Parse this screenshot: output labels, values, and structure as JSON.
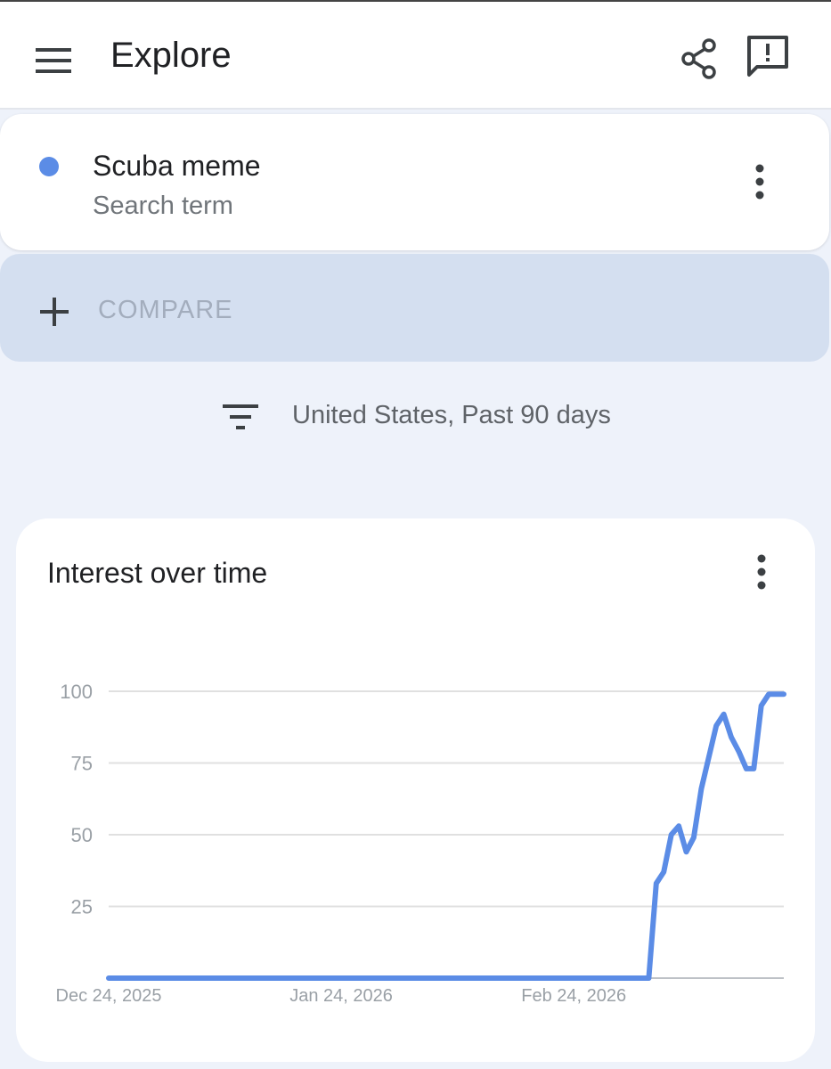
{
  "header": {
    "title": "Explore"
  },
  "term": {
    "name": "Scuba meme",
    "type": "Search term",
    "color": "#5b8ce6"
  },
  "compare": {
    "label": "COMPARE"
  },
  "filter": {
    "text": "United States, Past 90 days"
  },
  "chart_data": {
    "type": "line",
    "title": "Interest over time",
    "ylim": [
      0,
      100
    ],
    "yticks": [
      25,
      50,
      75,
      100
    ],
    "xticks": [
      "Dec 24, 2025",
      "Jan 24, 2026",
      "Feb 24, 2026"
    ],
    "xlim": [
      "2025-12-24",
      "2026-03-24"
    ],
    "grid": true,
    "color": "#5b8ce6",
    "series": [
      {
        "x": [
          "2025-12-24",
          "2026-01-01",
          "2026-01-15",
          "2026-02-01",
          "2026-02-15",
          "2026-03-01",
          "2026-03-06",
          "2026-03-07",
          "2026-03-08",
          "2026-03-09",
          "2026-03-10",
          "2026-03-11",
          "2026-03-12",
          "2026-03-13",
          "2026-03-14",
          "2026-03-15",
          "2026-03-16",
          "2026-03-17",
          "2026-03-18",
          "2026-03-19",
          "2026-03-20",
          "2026-03-21",
          "2026-03-22",
          "2026-03-23",
          "2026-03-24"
        ],
        "y": [
          0,
          0,
          0,
          0,
          0,
          0,
          0,
          33,
          37,
          50,
          53,
          44,
          49,
          66,
          77,
          88,
          92,
          84,
          79,
          73,
          73,
          95,
          99,
          99,
          99
        ]
      }
    ]
  }
}
